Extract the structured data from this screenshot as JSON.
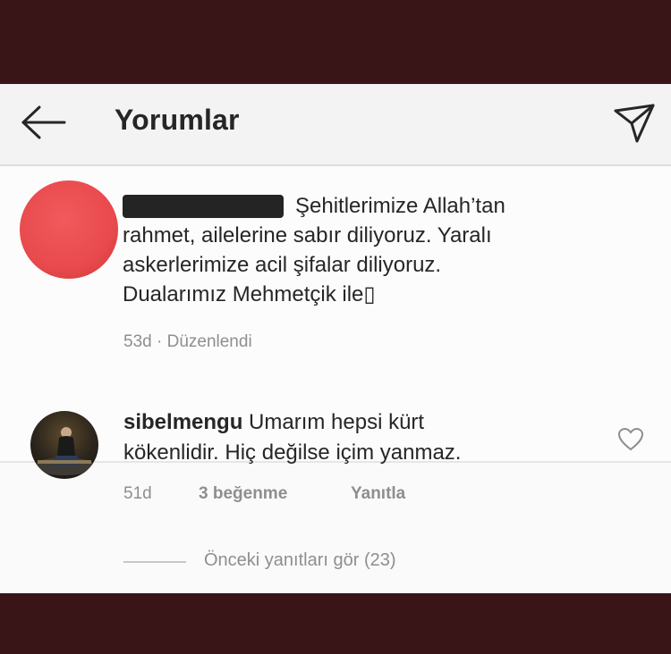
{
  "header": {
    "title": "Yorumlar"
  },
  "post": {
    "lines": [
      "Şehitlerimize Allah’tan",
      "rahmet, ailelerine sabır diliyoruz. Yaralı",
      "askerlerimize acil şifalar diliyoruz.",
      "Dualarımız Mehmetçik ile▯"
    ],
    "time": "53d",
    "separator": "·",
    "edited": "Düzenlendi"
  },
  "reply": {
    "username": "sibelmengu",
    "line1": "Umarım hepsi kürt",
    "line2": "kökenlidir. Hiç değilse içim yanmaz.",
    "time": "51d",
    "likes": "3 beğenme",
    "reply_label": "Yanıtla"
  },
  "view_replies": "Önceki yanıtları gör (23)",
  "colors": {
    "frame": "#3a1517",
    "background": "#fafafa",
    "text": "#262626",
    "muted": "#8e8e8e",
    "avatar_red": "#e94a4d"
  },
  "icons": [
    "back-arrow-icon",
    "send-icon",
    "heart-icon"
  ]
}
